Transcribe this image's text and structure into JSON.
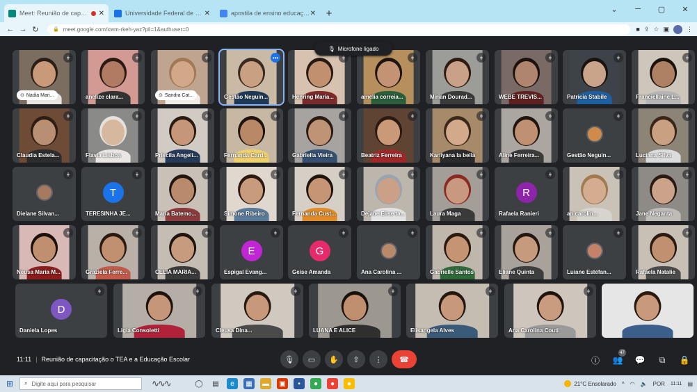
{
  "browser": {
    "tabs": [
      {
        "title": "Meet: Reunião de capacitação",
        "active": true,
        "recording": true,
        "favicon_color": "#00897b"
      },
      {
        "title": "Universidade Federal de São Carlos",
        "active": false,
        "recording": false,
        "favicon_color": "#1a73e8"
      },
      {
        "title": "apostila de ensino educação especial",
        "active": false,
        "recording": false,
        "favicon_color": "#4285f4"
      }
    ],
    "new_tab": "+",
    "url": "meet.google.com/xwm-rkeh-yaz?pli=1&authuser=0",
    "window_controls": [
      "⌄",
      "─",
      "▢",
      "✕"
    ]
  },
  "notice": {
    "text": "Microfone ligado"
  },
  "participants": [
    {
      "name": "Nadia Mari...",
      "pinned": true,
      "video": true,
      "bg": "#7b6e60",
      "skin": "#c89a7a",
      "hair": "#2b1e16",
      "shirt": "#e8e4df"
    },
    {
      "name": "anelize clara...",
      "pinned": false,
      "video": true,
      "bg": "#d29a92",
      "skin": "#b07a63",
      "hair": "#2a1a14",
      "shirt": "#333333"
    },
    {
      "name": "Sandra Cat...",
      "pinned": true,
      "video": true,
      "bg": "#bfa58f",
      "skin": "#d2a888",
      "hair": "#a07a55",
      "shirt": "#f0ede6"
    },
    {
      "name": "Gestão Neguin...",
      "pinned": false,
      "video": true,
      "bg": "#c9b9a5",
      "skin": "#c9a182",
      "hair": "#3a2a20",
      "shirt": "#1f3a57",
      "speaking": true
    },
    {
      "name": "Henring Maria...",
      "pinned": false,
      "video": true,
      "bg": "#d6c2ae",
      "skin": "#c0906f",
      "hair": "#2a1a14",
      "shirt": "#7a2a2a"
    },
    {
      "name": "amelia correia...",
      "pinned": false,
      "video": true,
      "bg": "#b78f5c",
      "skin": "#c39373",
      "hair": "#1e1410",
      "shirt": "#2a5f3a"
    },
    {
      "name": "Mirian Dourad...",
      "pinned": false,
      "video": true,
      "bg": "#9c9c98",
      "skin": "#c9a188",
      "hair": "#2c1c12",
      "shirt": "#3a3a3a"
    },
    {
      "name": "WEBE TREVIS...",
      "pinned": false,
      "video": true,
      "bg": "#7a6a66",
      "skin": "#b08570",
      "hair": "#1e120c",
      "shirt": "#602020"
    },
    {
      "name": "Patricia Stabile",
      "pinned": false,
      "video": true,
      "bg": "#3d4349",
      "skin": "#c9a48a",
      "hair": "#1a1410",
      "shirt": "#1d5fa0"
    },
    {
      "name": "Franciellaine L...",
      "pinned": false,
      "video": true,
      "bg": "#cfc6bb",
      "skin": "#ae8064",
      "hair": "#1a120c",
      "shirt": "#b5b5b5"
    },
    {
      "name": "Claudia Estela...",
      "pinned": false,
      "video": true,
      "bg": "#6e4b36",
      "skin": "#b98f73",
      "hair": "#2d1d12",
      "shirt": "#2d2d2d"
    },
    {
      "name": "Flavia Lisboa",
      "pinned": false,
      "video": true,
      "bg": "#8a8a88",
      "skin": "#d6b89f",
      "hair": "#e5e2de",
      "shirt": "#e9e6e3"
    },
    {
      "name": "Priscila Angeli...",
      "pinned": false,
      "video": true,
      "bg": "#d1cbc3",
      "skin": "#c59678",
      "hair": "#2a1b12",
      "shirt": "#263a5a"
    },
    {
      "name": "Fernanda Card...",
      "pinned": false,
      "video": true,
      "bg": "#c7b8a4",
      "skin": "#b98867",
      "hair": "#1e130d",
      "shirt": "#efd06e"
    },
    {
      "name": "Gabriella Vieira",
      "pinned": false,
      "video": true,
      "bg": "#a6a3a0",
      "skin": "#bf9476",
      "hair": "#2a1a12",
      "shirt": "#355070"
    },
    {
      "name": "Beatriz Ferreira",
      "pinned": false,
      "video": true,
      "bg": "#5f4434",
      "skin": "#c99978",
      "hair": "#2b1a10",
      "shirt": "#a02828"
    },
    {
      "name": "Karliyana la bella",
      "pinned": false,
      "video": true,
      "bg": "#a68a6a",
      "skin": "#d2a98a",
      "hair": "#3a2818",
      "shirt": "#2b2b2b"
    },
    {
      "name": "Aline Ferreira...",
      "pinned": false,
      "video": true,
      "bg": "#aca6a0",
      "skin": "#c09072",
      "hair": "#1f150f",
      "shirt": "#3b3b3b"
    },
    {
      "name": "Gestão Neguin...",
      "pinned": false,
      "video": false,
      "avatar_type": "photo",
      "avatar_color": "#d08a4a"
    },
    {
      "name": "Luciana Silva",
      "pinned": false,
      "video": true,
      "bg": "#8d8478",
      "skin": "#c9a182",
      "hair": "#3a2618",
      "shirt": "#dcdcdc"
    },
    {
      "name": "Dielane Silvan...",
      "pinned": false,
      "video": false,
      "avatar_type": "photo",
      "avatar_color": "#a77a60"
    },
    {
      "name": "TERESINHA JE...",
      "pinned": false,
      "video": false,
      "avatar_type": "letter",
      "letter": "T",
      "avatar_color": "#1a73e8"
    },
    {
      "name": "Maria Batemo...",
      "pinned": false,
      "video": true,
      "bg": "#c9c1b8",
      "skin": "#b98a6b",
      "hair": "#221610",
      "shirt": "#8a3a3a"
    },
    {
      "name": "Simone Ribeiro",
      "pinned": false,
      "video": true,
      "bg": "#e0d8cf",
      "skin": "#c99b7d",
      "hair": "#2a1a12",
      "shirt": "#5a7a9a"
    },
    {
      "name": "Fernanda Cust...",
      "pinned": false,
      "video": true,
      "bg": "#d6cfc5",
      "skin": "#c69575",
      "hair": "#1f140e",
      "shirt": "#e08a2a"
    },
    {
      "name": "Dejane Elise ta...",
      "pinned": false,
      "video": true,
      "bg": "#bdb6ad",
      "skin": "#caa086",
      "hair": "#9aa4b0",
      "shirt": "#e3e3e3"
    },
    {
      "name": "Laura Maga",
      "pinned": false,
      "video": true,
      "bg": "#a39e98",
      "skin": "#c89880",
      "hair": "#8a2a22",
      "shirt": "#3a3a3a"
    },
    {
      "name": "Rafaela Ranieri",
      "pinned": false,
      "video": false,
      "avatar_type": "letter",
      "letter": "R",
      "avatar_color": "#8e24aa"
    },
    {
      "name": "an carolin...",
      "pinned": false,
      "video": true,
      "bg": "#cac2b7",
      "skin": "#d4ad90",
      "hair": "#a07a50",
      "shirt": "#d7d3ce"
    },
    {
      "name": "Jane Neganta",
      "pinned": false,
      "video": true,
      "bg": "#8e8a85",
      "skin": "#caa38a",
      "hair": "#2a1b12",
      "shirt": "#bfbcb8"
    },
    {
      "name": "Neusa Maria M...",
      "pinned": false,
      "video": true,
      "bg": "#d9b9b5",
      "skin": "#bf8f6f",
      "hair": "#1a110c",
      "shirt": "#8a1c1c"
    },
    {
      "name": "Graziela Ferre...",
      "pinned": false,
      "video": true,
      "bg": "#b9b1a8",
      "skin": "#c09070",
      "hair": "#2a1a10",
      "shirt": "#c05a4a"
    },
    {
      "name": "CELIA MARIA...",
      "pinned": false,
      "video": true,
      "bg": "#c4bdb3",
      "skin": "#c69b7e",
      "hair": "#1f140d",
      "shirt": "#3a3a3a"
    },
    {
      "name": "Espigal Evang...",
      "pinned": false,
      "video": false,
      "avatar_type": "letter",
      "letter": "E",
      "avatar_color": "#c026d3"
    },
    {
      "name": "Geise Amanda",
      "pinned": false,
      "video": false,
      "avatar_type": "letter",
      "letter": "G",
      "avatar_color": "#e52b6b"
    },
    {
      "name": "Ana Carolina ...",
      "pinned": false,
      "video": false,
      "avatar_type": "photo",
      "avatar_color": "#b88a6a"
    },
    {
      "name": "Gabrielle Santos",
      "pinned": false,
      "video": true,
      "bg": "#bfb7ac",
      "skin": "#c59472",
      "hair": "#2b1a10",
      "shirt": "#2f6b3a"
    },
    {
      "name": "Eliane Quinta",
      "pinned": false,
      "video": true,
      "bg": "#a8a29b",
      "skin": "#c69a7c",
      "hair": "#241710",
      "shirt": "#3e3e3e"
    },
    {
      "name": "Luiane Estéfan...",
      "pinned": false,
      "video": false,
      "avatar_type": "photo",
      "avatar_color": "#c4826a"
    },
    {
      "name": "Rafaela Natalie",
      "pinned": false,
      "video": true,
      "bg": "#c8c0b5",
      "skin": "#c19070",
      "hair": "#2a1a12",
      "shirt": "#4a4a4a"
    },
    {
      "name": "Daniela Lopes",
      "pinned": false,
      "video": false,
      "avatar_type": "letter",
      "letter": "D",
      "avatar_color": "#7e57c2"
    },
    {
      "name": "Ligia Consoletti",
      "pinned": false,
      "video": true,
      "bg": "#b5aea6",
      "skin": "#c59678",
      "hair": "#1e130c",
      "shirt": "#b0223a"
    },
    {
      "name": "Cleusa Dina...",
      "pinned": false,
      "video": true,
      "bg": "#d0c9c0",
      "skin": "#c8987a",
      "hair": "#2a1b12",
      "shirt": "#4a4a4a"
    },
    {
      "name": "LUANA E ALICE",
      "pinned": false,
      "video": true,
      "bg": "#9c978f",
      "skin": "#c08f70",
      "hair": "#1a110b",
      "shirt": "#2f2f2f"
    },
    {
      "name": "Elisangela Alves",
      "pinned": false,
      "video": true,
      "bg": "#c6bdb2",
      "skin": "#c7987a",
      "hair": "#241710",
      "shirt": "#3a5a7a"
    },
    {
      "name": "Ana Carolina Couti",
      "pinned": false,
      "video": true,
      "bg": "#cec6bc",
      "skin": "#c99c80",
      "hair": "#1f130c",
      "shirt": "#9a9a9a"
    },
    {
      "name": "",
      "pinned": false,
      "video": true,
      "self": true,
      "bg": "#e6e6e6",
      "skin": "#c8997a",
      "hair": "#2a1a10",
      "shirt": "#3b5f8a"
    }
  ],
  "meeting": {
    "time": "11:11",
    "separator": "|",
    "title": "Reunião de capacitação o TEA e a Educação Escolar"
  },
  "controls": [
    {
      "name": "mic-button",
      "icon": "🎙"
    },
    {
      "name": "camera-button",
      "icon": "▭"
    },
    {
      "name": "raise-hand-button",
      "icon": "✋"
    },
    {
      "name": "present-button",
      "icon": "⇧"
    },
    {
      "name": "more-options-button",
      "icon": "⋮"
    },
    {
      "name": "leave-call-button",
      "icon": "☎"
    }
  ],
  "side_controls": [
    {
      "name": "meeting-details-button",
      "icon": "ⓘ"
    },
    {
      "name": "people-button",
      "icon": "👥",
      "badge": "47"
    },
    {
      "name": "chat-button",
      "icon": "💬"
    },
    {
      "name": "activities-button",
      "icon": "⧉"
    },
    {
      "name": "host-controls-button",
      "icon": "🔒"
    }
  ],
  "taskbar": {
    "search_placeholder": "Digite aqui para pesquisar",
    "weather": "21°C  Ensolarado",
    "clock_time": "11:11",
    "lang": "POR"
  }
}
